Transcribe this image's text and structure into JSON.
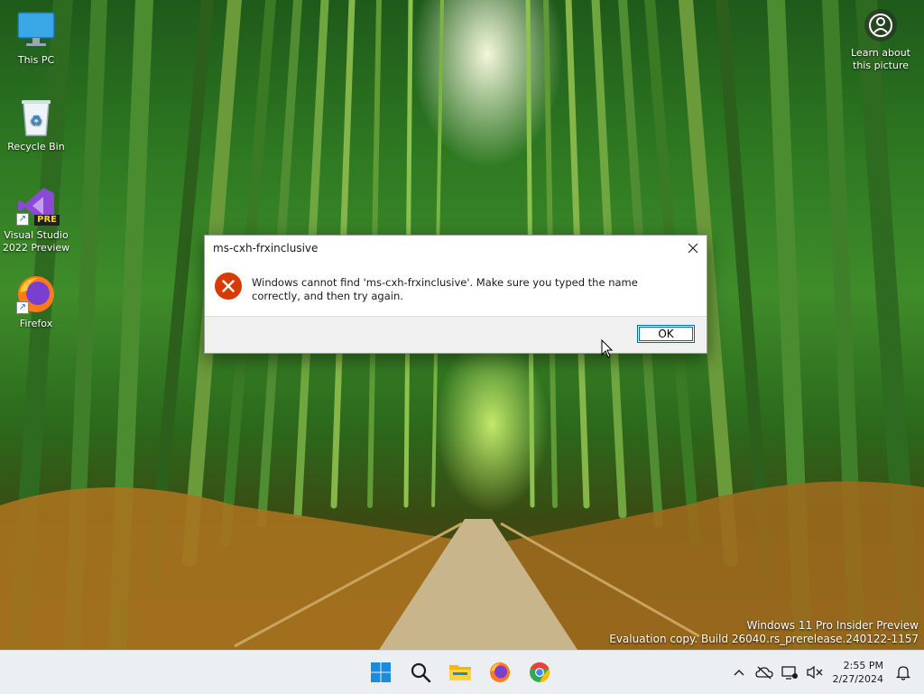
{
  "desktop": {
    "icons": [
      {
        "label": "This PC"
      },
      {
        "label": "Recycle Bin"
      },
      {
        "label": "Visual Studio 2022 Preview",
        "badge": "PRE"
      },
      {
        "label": "Firefox"
      }
    ],
    "learn_label": "Learn about this picture"
  },
  "dialog": {
    "title": "ms-cxh-frxinclusive",
    "message": "Windows cannot find 'ms-cxh-frxinclusive'. Make sure you typed the name correctly, and then try again.",
    "ok_label": "OK",
    "icon": "error-icon"
  },
  "watermark": {
    "line1": "Windows 11 Pro Insider Preview",
    "line2": "Evaluation copy. Build 26040.rs_prerelease.240122-1157"
  },
  "taskbar": {
    "apps": [
      "start-icon",
      "search-icon",
      "file-explorer-icon",
      "firefox-icon",
      "chrome-icon"
    ],
    "tray": [
      "chevron-up-icon",
      "onedrive-offline-icon",
      "network-icon",
      "speaker-muted-icon"
    ],
    "time": "2:55 PM",
    "date": "2/27/2024"
  },
  "colors": {
    "accent": "#0067c0",
    "error": "#d83b01",
    "taskbar_bg": "#eceff2"
  }
}
